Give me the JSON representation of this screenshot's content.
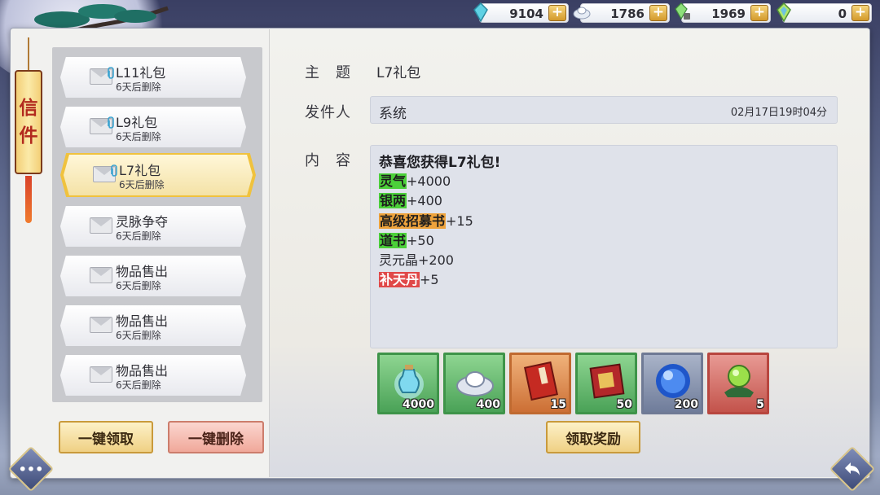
{
  "resources": [
    {
      "icon": "crystal-icon",
      "value": "9104"
    },
    {
      "icon": "silver-ingot-icon",
      "value": "1786"
    },
    {
      "icon": "locked-gem-icon",
      "value": "1969"
    },
    {
      "icon": "jade-gem-icon",
      "value": "0"
    }
  ],
  "tab": {
    "char1": "信",
    "char2": "件"
  },
  "mail_list": [
    {
      "title": "L11礼包",
      "sub": "6天后删除",
      "has_attachment": true
    },
    {
      "title": "L9礼包",
      "sub": "6天后删除",
      "has_attachment": true
    },
    {
      "title": "L7礼包",
      "sub": "6天后删除",
      "has_attachment": true,
      "selected": true
    },
    {
      "title": "灵脉争夺",
      "sub": "6天后删除",
      "has_attachment": false
    },
    {
      "title": "物品售出",
      "sub": "6天后删除",
      "has_attachment": false
    },
    {
      "title": "物品售出",
      "sub": "6天后删除",
      "has_attachment": false
    },
    {
      "title": "物品售出",
      "sub": "6天后删除",
      "has_attachment": false
    }
  ],
  "buttons": {
    "claim_all": "一键领取",
    "delete_all": "一键删除",
    "claim_reward": "领取奖励"
  },
  "detail": {
    "subject_label": "主　题",
    "subject": "L7礼包",
    "sender_label": "发件人",
    "sender": "系统",
    "time": "02月17日19时04分",
    "content_label": "内　容",
    "greeting": "恭喜您获得L7礼包!",
    "lines": [
      {
        "name": "灵气",
        "amount": "+4000",
        "color": "green"
      },
      {
        "name": "银两",
        "amount": "+400",
        "color": "green"
      },
      {
        "name": "高级招募书",
        "amount": "+15",
        "color": "gold"
      },
      {
        "name": "道书",
        "amount": "+50",
        "color": "green"
      },
      {
        "name": "灵元晶",
        "amount": "+200",
        "color": "none"
      },
      {
        "name": "补天丹",
        "amount": "+5",
        "color": "red"
      }
    ]
  },
  "rewards": [
    {
      "icon": "spirit-bottle-icon",
      "count": "4000",
      "rarity": "green"
    },
    {
      "icon": "silver-ingot-icon",
      "count": "400",
      "rarity": "green"
    },
    {
      "icon": "red-book-icon",
      "count": "15",
      "rarity": "orange"
    },
    {
      "icon": "dao-book-icon",
      "count": "50",
      "rarity": "green"
    },
    {
      "icon": "blue-orb-icon",
      "count": "200",
      "rarity": "blue"
    },
    {
      "icon": "green-pill-icon",
      "count": "5",
      "rarity": "red"
    }
  ],
  "colors": {
    "highlight_green": "#4cd03a",
    "highlight_gold": "#eea33c",
    "highlight_red": "#e04848",
    "gold_button": "#efd084",
    "red_button": "#f0a89a"
  }
}
